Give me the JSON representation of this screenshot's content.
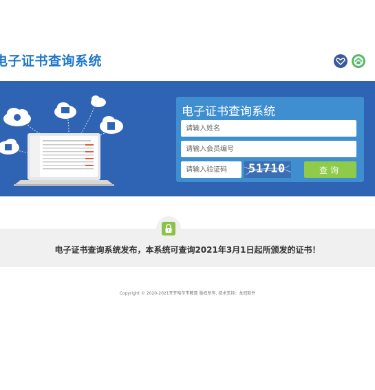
{
  "header": {
    "site_title": "电子证书查询系统",
    "favorite_icon": "heart-icon",
    "home_icon": "home-icon"
  },
  "login": {
    "title": "电子证书查询系统",
    "name_placeholder": "请输入姓名",
    "member_placeholder": "请输入会员编号",
    "code_placeholder": "请输入验证码",
    "captcha_text": "51710",
    "query_label": "查询"
  },
  "notice": {
    "text": "电子证书查询系统发布，本系统可查询2021年3月1日起所颁发的证书！"
  },
  "footer": {
    "copyright": "Copyright © 2020-2021齐齐哈尔市教育 版权所有, 技术支持：龙冠软件"
  },
  "colors": {
    "banner": "#2f63b3",
    "panel": "#3f8fd0",
    "button": "#8ecb4a",
    "title": "#1f78c8"
  }
}
